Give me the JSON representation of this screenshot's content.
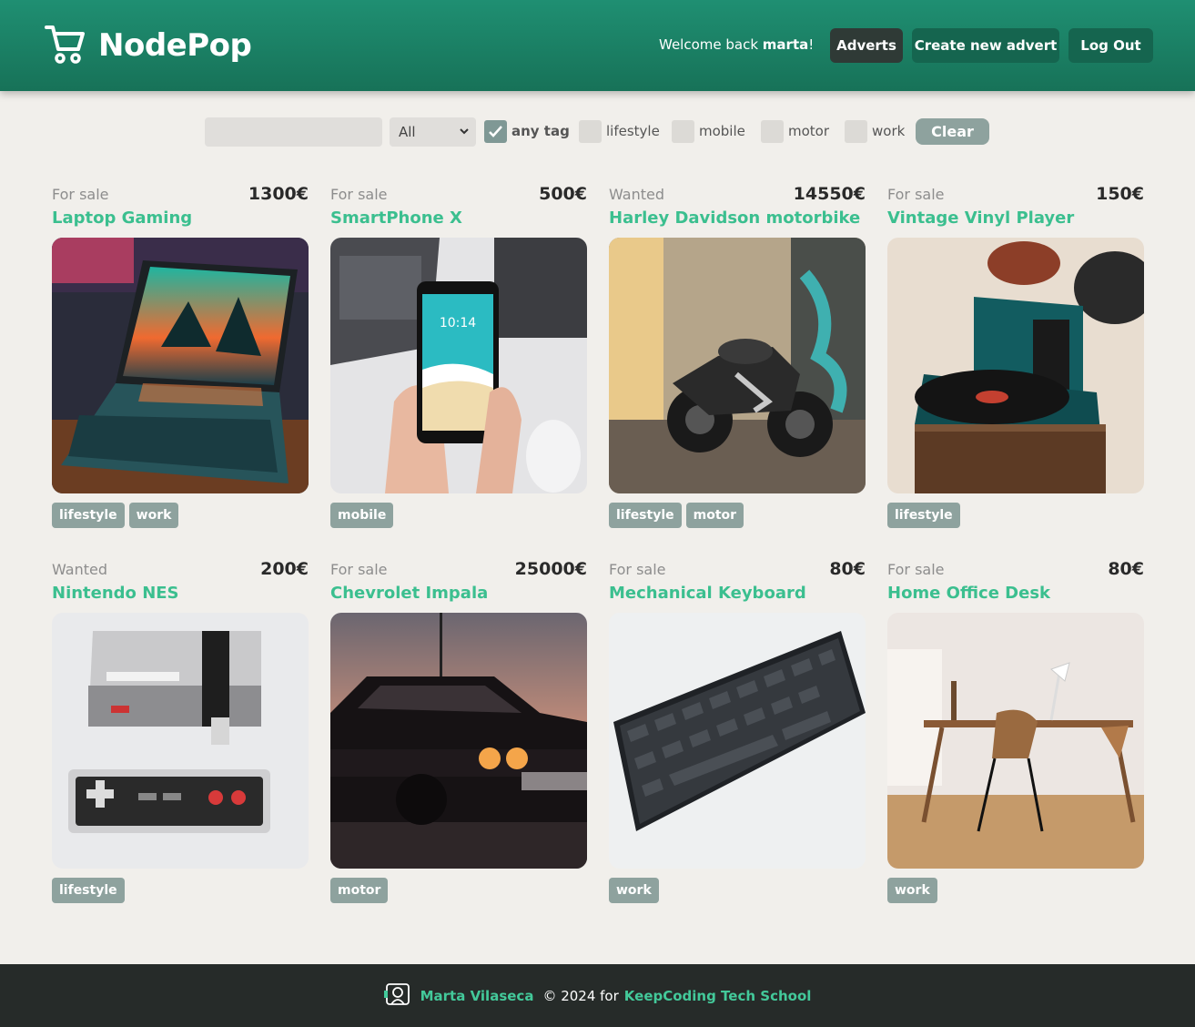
{
  "header": {
    "app_name": "NodePop",
    "welcome_prefix": "Welcome back ",
    "username": "marta",
    "welcome_suffix": "!",
    "nav": [
      "Adverts",
      "Create new advert",
      "Log Out"
    ]
  },
  "filters": {
    "search_value": "",
    "sale_select": "All",
    "any_tag_label": "any tag",
    "any_tag_checked": true,
    "tags": [
      "lifestyle",
      "mobile",
      "motor",
      "work"
    ],
    "clear_label": "Clear"
  },
  "adverts": [
    {
      "type": "For sale",
      "price": "1300€",
      "name": "Laptop Gaming",
      "tags": [
        "lifestyle",
        "work"
      ],
      "image": "laptop"
    },
    {
      "type": "For sale",
      "price": "500€",
      "name": "SmartPhone X",
      "tags": [
        "mobile"
      ],
      "image": "phone"
    },
    {
      "type": "Wanted",
      "price": "14550€",
      "name": "Harley Davidson motorbike",
      "tags": [
        "lifestyle",
        "motor"
      ],
      "image": "motorbike"
    },
    {
      "type": "For sale",
      "price": "150€",
      "name": "Vintage Vinyl Player",
      "tags": [
        "lifestyle"
      ],
      "image": "vinyl"
    },
    {
      "type": "Wanted",
      "price": "200€",
      "name": "Nintendo NES",
      "tags": [
        "lifestyle"
      ],
      "image": "nes"
    },
    {
      "type": "For sale",
      "price": "25000€",
      "name": "Chevrolet Impala",
      "tags": [
        "motor"
      ],
      "image": "car"
    },
    {
      "type": "For sale",
      "price": "80€",
      "name": "Mechanical Keyboard",
      "tags": [
        "work"
      ],
      "image": "keyboard"
    },
    {
      "type": "For sale",
      "price": "80€",
      "name": "Home Office Desk",
      "tags": [
        "work"
      ],
      "image": "desk"
    }
  ],
  "footer": {
    "author": "Marta Vilaseca",
    "copyright": "© 2024 for",
    "school": "KeepCoding Tech School"
  },
  "colors": {
    "header": "#1f8f72",
    "accent": "#3bbf8f",
    "tag_bg": "#8ea29e",
    "footer_bg": "#262b29",
    "page_bg": "#f1efeb"
  }
}
